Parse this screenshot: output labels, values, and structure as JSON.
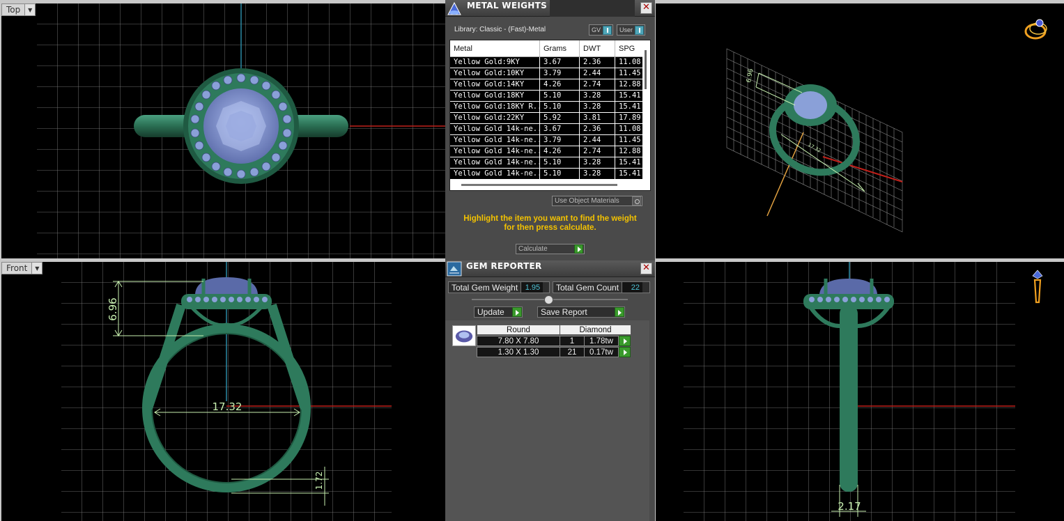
{
  "views": {
    "top_label": "Top",
    "front_label": "Front"
  },
  "dimensions": {
    "height": "6.96",
    "diameter": "17.32",
    "shank_height": "1.72",
    "shank_width": "2.17",
    "iso_a": "6.96",
    "iso_b": "17.32"
  },
  "metal_weights": {
    "title": "METAL WEIGHTS",
    "library": "Library: Classic - (Fast)-Metal",
    "toggle_gv": "GV",
    "toggle_user": "User",
    "columns": [
      "Metal",
      "Grams",
      "DWT",
      "SPG"
    ],
    "rows": [
      [
        "Yellow Gold:9KY",
        "3.67",
        "2.36",
        "11.08"
      ],
      [
        "Yellow Gold:10KY",
        "3.79",
        "2.44",
        "11.45"
      ],
      [
        "Yellow Gold:14KY",
        "4.26",
        "2.74",
        "12.88"
      ],
      [
        "Yellow Gold:18KY",
        "5.10",
        "3.28",
        "15.41"
      ],
      [
        "Yellow Gold:18KY R...",
        "5.10",
        "3.28",
        "15.41"
      ],
      [
        "Yellow Gold:22KY",
        "5.92",
        "3.81",
        "17.89"
      ],
      [
        "Yellow Gold 14k-ne...",
        "3.67",
        "2.36",
        "11.08"
      ],
      [
        "Yellow Gold 14k-ne...",
        "3.79",
        "2.44",
        "11.45"
      ],
      [
        "Yellow Gold 14k-ne...",
        "4.26",
        "2.74",
        "12.88"
      ],
      [
        "Yellow Gold 14k-ne...",
        "5.10",
        "3.28",
        "15.41"
      ],
      [
        "Yellow Gold 14k-ne...",
        "5.10",
        "3.28",
        "15.41"
      ]
    ],
    "use_object_materials": "Use Object Materials",
    "hint_line1": "Highlight the item you want to find the weight",
    "hint_line2": "for then press calculate.",
    "calculate": "Calculate"
  },
  "gem_reporter": {
    "title": "GEM REPORTER",
    "total_gem_weight_label": "Total Gem Weight",
    "total_gem_weight": "1.95",
    "total_gem_count_label": "Total Gem Count",
    "total_gem_count": "22",
    "update": "Update",
    "save_report": "Save Report",
    "shape": "Round",
    "material": "Diamond",
    "gems": [
      {
        "size": "7.80 X 7.80",
        "count": "1",
        "weight": "1.78tw"
      },
      {
        "size": "1.30 X 1.30",
        "count": "21",
        "weight": "0.17tw"
      }
    ]
  },
  "colors": {
    "metal": "#2e7a5c",
    "gem": "#8aa0d8",
    "grid": "#9a9a9a",
    "axis_red": "#c0201a",
    "axis_blue": "#2a8aa6",
    "dim_green": "#c8f0b0",
    "hint": "#f3c200",
    "value_cyan": "#4ec3d6"
  },
  "icons": [
    "dropdown-arrow-icon",
    "metal-weights-icon",
    "gem-reporter-icon",
    "close-icon",
    "ring-orbit-icon",
    "pendant-icon",
    "go-arrow-icon",
    "gem-thumbnail-icon"
  ]
}
